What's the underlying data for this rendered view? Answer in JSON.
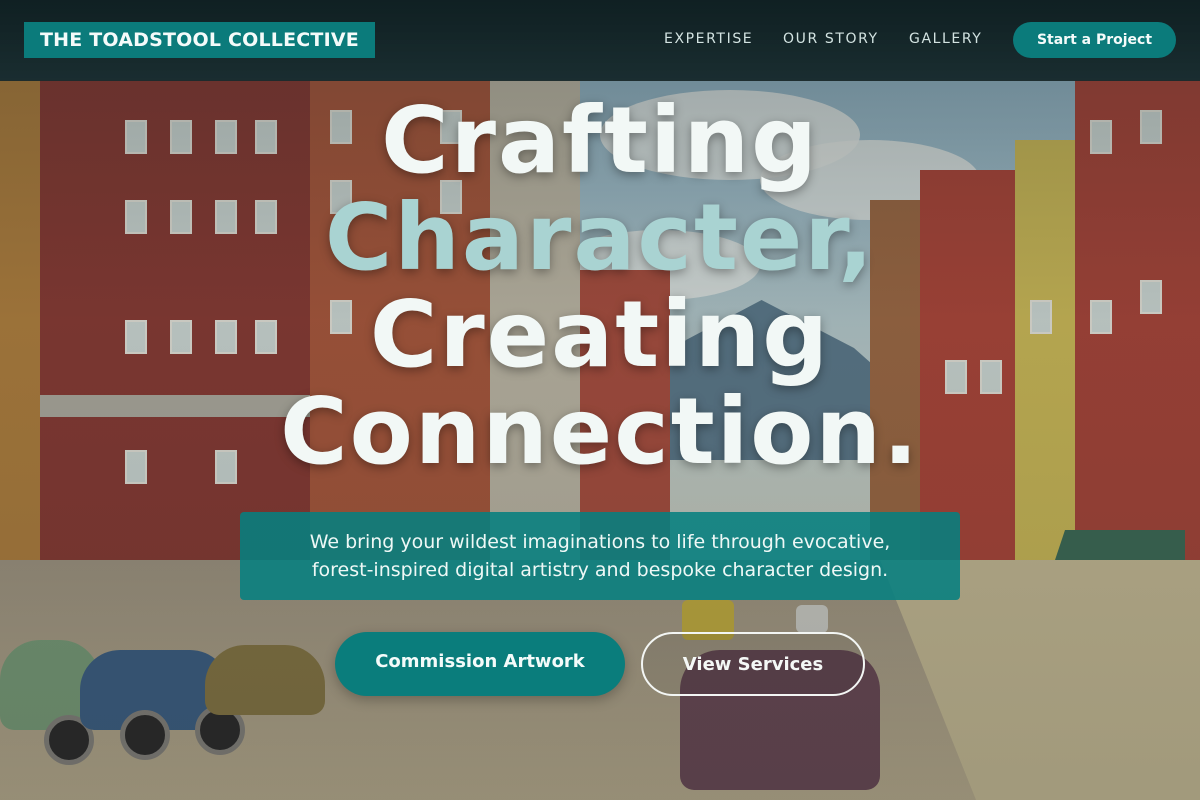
{
  "brand": {
    "name": "THE TOADSTOOL COLLECTIVE"
  },
  "nav": {
    "items": [
      {
        "label": "EXPERTISE"
      },
      {
        "label": "OUR STORY"
      },
      {
        "label": "GALLERY"
      }
    ],
    "cta_label": "Start a Project"
  },
  "hero": {
    "headline": {
      "line1": "Crafting",
      "line2": "Character,",
      "line3": "Creating",
      "line4": "Connection."
    },
    "tagline_line1": "We bring your wildest imaginations to life through evocative,",
    "tagline_line2": "forest-inspired digital artistry and bespoke character design.",
    "primary_button": "Commission Artwork",
    "secondary_button": "View Services"
  },
  "colors": {
    "accent": "#0b7b7b",
    "headline_accent": "#a9d3d2",
    "header_bg": "#0e2022"
  }
}
